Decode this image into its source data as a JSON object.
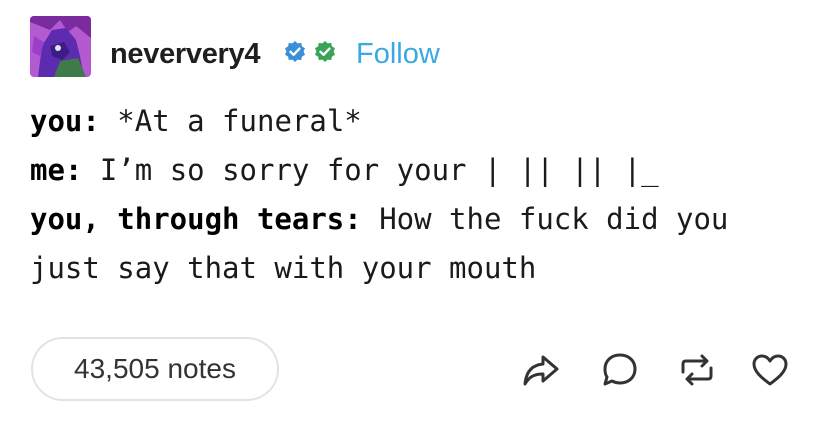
{
  "post": {
    "author": {
      "username": "neververy4",
      "badges": [
        "blue-verified-icon",
        "green-verified-icon"
      ],
      "follow_label": "Follow"
    },
    "lines": [
      {
        "speaker": "you:",
        "text": " *At a funeral*"
      },
      {
        "speaker": "me:",
        "text": " I’m so sorry for your | || || |_"
      },
      {
        "speaker": "you, through tears:",
        "text": " How the fuck did you"
      },
      {
        "speaker": "",
        "text": "just say that with your mouth"
      }
    ],
    "notes_label": "43,505 notes",
    "actions": [
      "share-icon",
      "reply-icon",
      "reblog-icon",
      "like-icon"
    ]
  },
  "colors": {
    "follow": "#3aa9e0",
    "badge_blue": "#3b8fd6",
    "badge_green": "#3aa356",
    "icon": "#333333"
  }
}
